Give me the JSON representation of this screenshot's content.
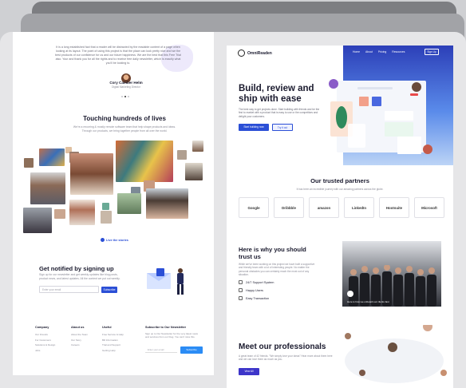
{
  "colors": {
    "primary": "#2b4fd6",
    "hero_gradient_top": "#2c3fb8",
    "meet_button": "#3d35c9",
    "newsletter_button": "#2b8cf5"
  },
  "left_page": {
    "testimonial": {
      "quote": "It is a long established fact that a reader will be distracted by the readable content of a page when looking at its layout. The point of using this project is that the place can look pretty nice and we the best products of our confidence for us and our future happiness. We are the best that this Free Trial also. Your and thank you for all the rights and to receive free daily newsletter, which is exactly what you'll be looking to.",
      "name": "Cory Camber Helm",
      "role": "Digital Marketing Director"
    },
    "touching": {
      "title": "Touching hundreds of lives",
      "subtitle": "We're a recurring & mostly remote software team that help shape products and ideas. Through our products, we bring together people from all over the world."
    },
    "live_link": "Live the stories",
    "notify": {
      "title": "Get notified by signing up",
      "desc": "Sign up for our newsletter and get weekly updates like blog posts, product news, and latest updates. All the content we put out weekly.",
      "email_placeholder": "Enter your email",
      "button": "Subscribe"
    },
    "footer": {
      "columns": [
        {
          "heading": "Company",
          "items": [
            "Our Friends",
            "For Customers",
            "Solutions & Design",
            "Jobs"
          ]
        },
        {
          "heading": "About us",
          "items": [
            "About the Team",
            "Our Story",
            "Careers"
          ]
        },
        {
          "heading": "Useful",
          "items": [
            "Free Service & Help",
            "Bill Information",
            "Trial and Support",
            "Getting Help"
          ]
        }
      ],
      "newsletter": {
        "heading": "Subscribe to Our Newsletter",
        "text": "Sign up to Our Newsletter for the very latest news and services from our blog. You can't miss this.",
        "placeholder": "Enter your email",
        "button": "Subscribe"
      }
    }
  },
  "right_page": {
    "brand": "OmniReaden",
    "nav": [
      "Home",
      "About",
      "Pricing",
      "Resources"
    ],
    "signup": "Sign Up",
    "hero": {
      "title": "Build, review and ship with ease",
      "desc": "The best way to get projects done. Start building with friends and be the first to market with a product that is easy to use or the competitors and delight your customers.",
      "primary_button": "Start building now",
      "secondary_button": "Try it out"
    },
    "partners": {
      "title": "Our trusted partners",
      "subtitle": "It has been an incredible journey with our amazing partners across the globe.",
      "logos": [
        "Google",
        "Dribbble",
        "amazon",
        "LinkedIn",
        "Hootsuite",
        "Microsoft"
      ]
    },
    "why": {
      "title": "Here is why you should trust us",
      "desc": "While we've been working on this project we have built a supportive and friendly team with a lot of interesting people. No matter the personal obstacles you can certainly reach the most out of any situation.",
      "features": [
        "24/7 Support System",
        "Happy Users",
        "Easy Transaction"
      ],
      "video_caption": "Here is how we onboard our clients fast"
    },
    "meet": {
      "title": "Meet our professionals",
      "desc": "A great team of 42 friends. \"We simply love your ideas\" Hear more about them here and we can love them as much as you.",
      "button": "View All"
    }
  }
}
